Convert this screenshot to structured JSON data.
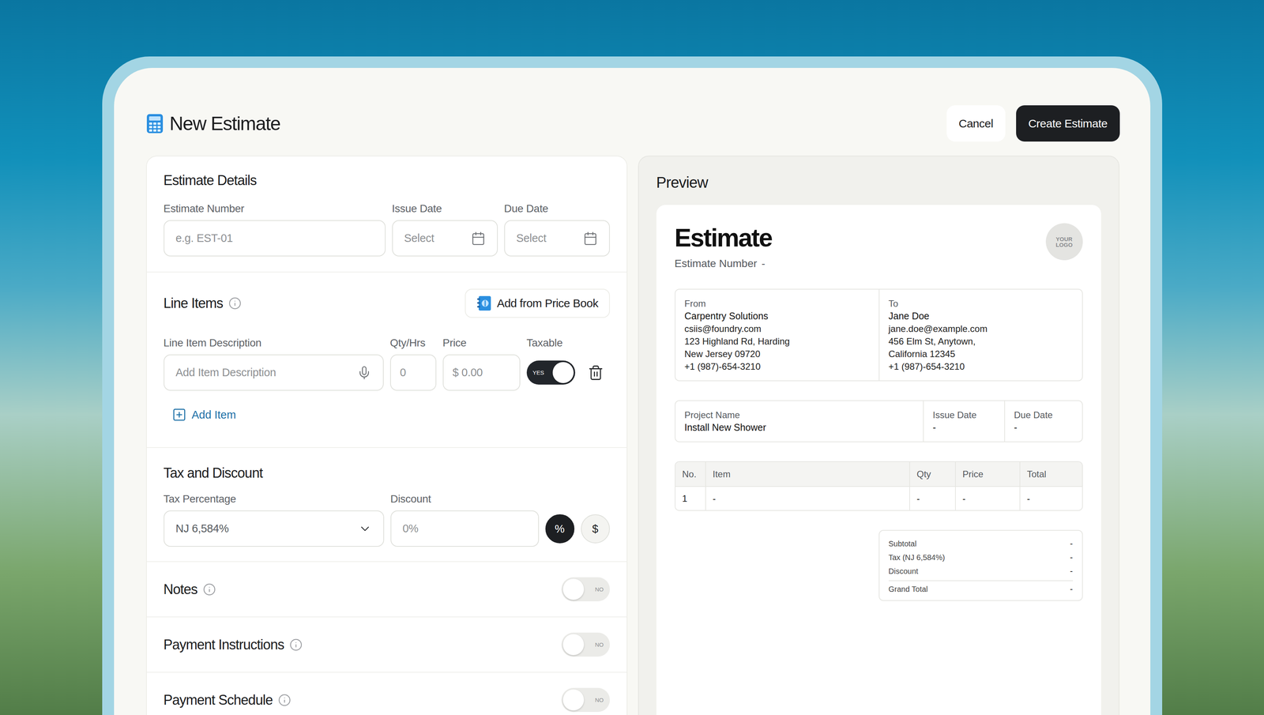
{
  "window": {
    "title": "New Estimate"
  },
  "header_buttons": [
    {
      "label": "Cancel",
      "kind": "secondary"
    },
    {
      "label": "Create Estimate",
      "kind": "primary"
    }
  ],
  "estimate_details": {
    "title": "Estimate Details",
    "fields": [
      {
        "label": "Estimate Number",
        "placeholder": "e.g. EST-01",
        "kind": "text"
      },
      {
        "label": "Issue Date",
        "placeholder": "Select",
        "kind": "date"
      },
      {
        "label": "Due Date",
        "placeholder": "Select",
        "kind": "date"
      }
    ]
  },
  "line_items": {
    "title": "Line Items",
    "info": true,
    "price_book_button": "Add from Price Book",
    "columns": [
      "Line Item Description",
      "Qty/Hrs",
      "Price",
      "Taxable"
    ],
    "rows": [
      {
        "description_placeholder": "Add Item Description",
        "qty_placeholder": "0",
        "price_placeholder": "$ 0.00",
        "taxable": true,
        "taxable_label": "YES"
      }
    ],
    "add_button": "Add Item"
  },
  "tax_and_discount": {
    "title": "Tax and Discount",
    "tax_label": "Tax Percentage",
    "tax_value": "NJ 6,584%",
    "discount_label": "Discount",
    "discount_placeholder": "0%",
    "discount_units": [
      {
        "label": "%",
        "selected": true
      },
      {
        "label": "$",
        "selected": false
      }
    ]
  },
  "toggle_sections": [
    {
      "title": "Notes",
      "info": true,
      "on": false,
      "label": "NO"
    },
    {
      "title": "Payment Instructions",
      "info": true,
      "on": false,
      "label": "NO"
    },
    {
      "title": "Payment Schedule",
      "info": true,
      "on": false,
      "label": "NO"
    }
  ],
  "preview": {
    "title": "Preview",
    "document": {
      "heading": "Estimate",
      "number_label": "Estimate Number",
      "number_value": "-",
      "logo": "YOUR LOGO",
      "parties": [
        {
          "label": "From",
          "name": "Carpentry Solutions",
          "lines": [
            "csiis@foundry.com",
            "123 Highland Rd, Harding",
            "New Jersey 09720",
            "+1 (987)-654-3210"
          ]
        },
        {
          "label": "To",
          "name": "Jane Doe",
          "lines": [
            "jane.doe@example.com",
            "456 Elm St, Anytown,",
            "California 12345",
            "+1 (987)-654-3210"
          ]
        }
      ],
      "meta": [
        {
          "label": "Project Name",
          "value": "Install New Shower"
        },
        {
          "label": "Issue Date",
          "value": "-"
        },
        {
          "label": "Due Date",
          "value": "-"
        }
      ],
      "table": {
        "columns": [
          "No.",
          "Item",
          "Qty",
          "Price",
          "Total"
        ],
        "rows": [
          [
            "1",
            "-",
            "-",
            "-",
            "-"
          ]
        ]
      },
      "totals": [
        {
          "label": "Subtotal",
          "value": "-",
          "kind": "line"
        },
        {
          "label": "Tax (NJ 6,584%)",
          "value": "-",
          "kind": "line"
        },
        {
          "label": "Discount",
          "value": "-",
          "kind": "line"
        },
        {
          "label": "Grand Total",
          "value": "-",
          "kind": "grand"
        }
      ]
    }
  }
}
